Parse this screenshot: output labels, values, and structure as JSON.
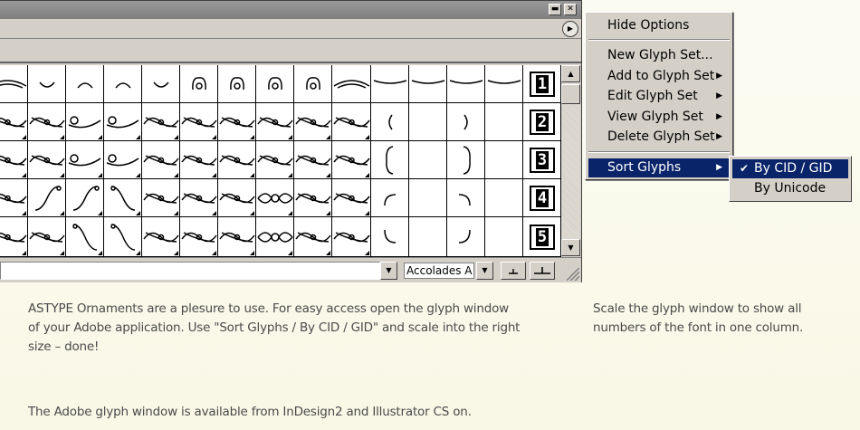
{
  "window": {
    "minimize_icon": "minimize-icon",
    "close_icon": "close-icon",
    "flyout_icon": "flyout-menu-icon"
  },
  "glyph_rows": [
    [
      "ornament-top-swash",
      "ornament-arc-down",
      "ornament-arc-up",
      "ornament-cap",
      "ornament-bowl",
      "ornament-hook-pair",
      "ornament-knot",
      "ornament-trefoil",
      "ornament-sprig",
      "ornament-wide-swash",
      "ornament-arc-long",
      "ornament-arc-wider",
      "ornament-tilde",
      "ornament-rule"
    ],
    [
      "ornament-double-scroll",
      "ornament-scroll-left",
      "ornament-tail-left",
      "ornament-tail-right",
      "ornament-flourish-a",
      "ornament-flourish-b",
      "ornament-flourish-c",
      "ornament-flourish-d",
      "ornament-flourish-e",
      "ornament-flourish-f",
      "paren-open-small",
      "blank",
      "paren-close-small",
      "blank"
    ],
    [
      "ornament-scroll-wave",
      "ornament-scroll-curl",
      "ornament-tail-curl",
      "ornament-tail-wave",
      "ornament-flourish-g",
      "ornament-flourish-h",
      "ornament-flourish-i",
      "ornament-flourish-j",
      "ornament-flourish-k",
      "ornament-flourish-l",
      "paren-open-tall",
      "blank",
      "paren-close-tall",
      "blank"
    ],
    [
      "ornament-scroll-s",
      "ornament-swan",
      "ornament-s-rise",
      "ornament-s-fall",
      "ornament-flourish-m",
      "ornament-flourish-n",
      "ornament-flourish-o",
      "ornament-center-rosette",
      "ornament-flourish-p",
      "ornament-flourish-q",
      "corner-open-top",
      "blank",
      "corner-close-top",
      "blank"
    ],
    [
      "ornament-scroll-hook",
      "ornament-leaf-pair",
      "ornament-c-curve",
      "ornament-c-curve-b",
      "ornament-flourish-r",
      "ornament-flourish-s",
      "ornament-flourish-t",
      "ornament-center-rosette-b",
      "ornament-flourish-u",
      "ornament-flourish-v",
      "corner-open-bottom",
      "blank",
      "corner-close-bottom",
      "blank"
    ]
  ],
  "row_numbers": [
    "1",
    "2",
    "3",
    "4",
    "5"
  ],
  "bottom_bar": {
    "font_name": "Accolades A",
    "dropdown_icon": "chevron-down-icon",
    "smaller_icon": "zoom-out-icon",
    "larger_icon": "zoom-in-icon"
  },
  "menu": {
    "items": [
      {
        "label": "Hide Options",
        "has_submenu": false
      },
      {
        "label": "New Glyph Set...",
        "has_submenu": false
      },
      {
        "label": "Add to Glyph Set",
        "has_submenu": true
      },
      {
        "label": "Edit Glyph Set",
        "has_submenu": true
      },
      {
        "label": "View Glyph Set",
        "has_submenu": true
      },
      {
        "label": "Delete Glyph Set",
        "has_submenu": true
      },
      {
        "label": "Sort Glyphs",
        "has_submenu": true,
        "selected": true
      }
    ],
    "submenu": [
      {
        "label": "By CID / GID",
        "checked": true,
        "selected": true
      },
      {
        "label": "By Unicode",
        "checked": false,
        "selected": false
      }
    ]
  },
  "text": {
    "p1_line1": "ASTYPE Ornaments are a plesure to use. For easy access open the glyph window",
    "p1_line2": "of your Adobe application.  Use \"Sort Glyphs / By CID / GID\" and scale into the right",
    "p1_line3": "size – done!",
    "p2": "The Adobe glyph window is available from InDesign2 and Illustrator CS on.",
    "side_line1": "Scale the glyph window to show all",
    "side_line2": "numbers of the font in one column."
  },
  "colors": {
    "menu_highlight": "#0a246a",
    "panel": "#d4d0c8",
    "text": "#4a4a4a"
  }
}
